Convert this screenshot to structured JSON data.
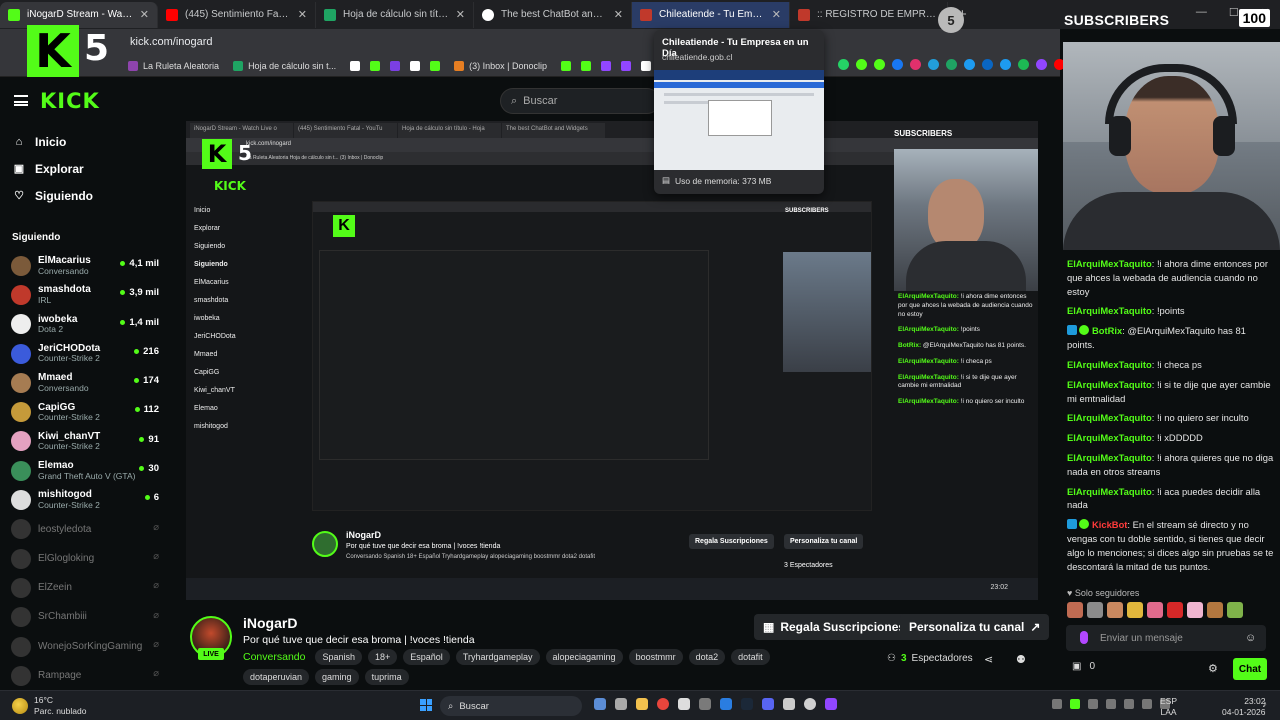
{
  "browser": {
    "tabs": [
      {
        "title": "iNogarD Stream - Watch Live o",
        "color": "#53fc18"
      },
      {
        "title": "(445) Sentimiento Fatal - YouTu",
        "color": "#ff0000"
      },
      {
        "title": "Hoja de cálculo sin título - Hoja",
        "color": "#1fa463"
      },
      {
        "title": "The best ChatBot and Widgets",
        "color": "#ffffff"
      },
      {
        "title": "Chileatiende - Tu Empresa en u",
        "color": "#c0392b"
      },
      {
        "title": ":: REGISTRO DE EMPRESAS",
        "color": "#c0392b"
      }
    ],
    "address": "kick.com/inogard",
    "bookmarks": [
      {
        "label": "La Ruleta Aleatoria",
        "color": "#8e44ad"
      },
      {
        "label": "Hoja de cálculo sin t...",
        "color": "#1fa463"
      },
      {
        "label": "(3) Inbox | Donoclip",
        "color": "#e67e22"
      }
    ]
  },
  "overlay": {
    "logo_letter": "K",
    "logo_number": "5",
    "subscribers_level": "5",
    "subscribers_label": "SUBSCRIBERS",
    "subscribers_count": "100"
  },
  "tooltip": {
    "title": "Chileatiende - Tu Empresa en un Día",
    "url": "chileatiende.gob.cl",
    "memory": "Uso de memoria: 373 MB"
  },
  "kick": {
    "logo": "KICK",
    "search_placeholder": "Buscar",
    "nav": [
      {
        "label": "Inicio",
        "icon": "home-icon",
        "glyph": "⌂"
      },
      {
        "label": "Explorar",
        "icon": "explore-icon",
        "glyph": "▣"
      },
      {
        "label": "Siguiendo",
        "icon": "heart-icon",
        "glyph": "♡"
      }
    ],
    "following_header": "Siguiendo",
    "channels": [
      {
        "name": "ElMacarius",
        "category": "Conversando",
        "viewers": "4,1 mil",
        "color": "#7b5a3a",
        "live": true
      },
      {
        "name": "smashdota",
        "category": "IRL",
        "viewers": "3,9 mil",
        "color": "#c0392b",
        "live": true
      },
      {
        "name": "iwobeka",
        "category": "Dota 2",
        "viewers": "1,4 mil",
        "color": "#eeeeee",
        "live": true
      },
      {
        "name": "JeriCHODota",
        "category": "Counter-Strike 2",
        "viewers": "216",
        "color": "#3b5bdb",
        "live": true
      },
      {
        "name": "Mmaed",
        "category": "Conversando",
        "viewers": "174",
        "color": "#a67c52",
        "live": true
      },
      {
        "name": "CapiGG",
        "category": "Counter-Strike 2",
        "viewers": "112",
        "color": "#c59a3a",
        "live": true
      },
      {
        "name": "Kiwi_chanVT",
        "category": "Counter-Strike 2",
        "viewers": "91",
        "color": "#e4a1c0",
        "live": true
      },
      {
        "name": "Elemao",
        "category": "Grand Theft Auto V (GTA)",
        "viewers": "30",
        "color": "#3a8f5a",
        "live": true
      },
      {
        "name": "mishitogod",
        "category": "Counter-Strike 2",
        "viewers": "6",
        "color": "#dddddd",
        "live": true
      },
      {
        "name": "leostyledota",
        "category": "",
        "viewers": "",
        "color": "#333",
        "live": false
      },
      {
        "name": "ElGlogloking",
        "category": "",
        "viewers": "",
        "color": "#333",
        "live": false
      },
      {
        "name": "ElZeein",
        "category": "",
        "viewers": "",
        "color": "#333",
        "live": false
      },
      {
        "name": "SrChambiii",
        "category": "",
        "viewers": "",
        "color": "#333",
        "live": false
      },
      {
        "name": "WonejoSorKingGaming",
        "category": "",
        "viewers": "",
        "color": "#333",
        "live": false
      },
      {
        "name": "Rampage",
        "category": "",
        "viewers": "",
        "color": "#333",
        "live": false
      }
    ]
  },
  "stream": {
    "streamer": "iNogarD",
    "title": "Por qué tuve que decir esa broma | !voces !tienda",
    "live_label": "LIVE",
    "category": "Conversando",
    "tags": [
      "Spanish",
      "18+",
      "Español",
      "Tryhardgameplay",
      "alopeciagaming",
      "boostmmr",
      "dota2",
      "dotafit"
    ],
    "tags2": [
      "dotaperuvian",
      "gaming",
      "tuprima"
    ],
    "subs_button": "Regala Suscripciones",
    "customize_button": "Personaliza tu canal",
    "viewers_count": "3",
    "viewers_label": "Espectadores"
  },
  "chat": {
    "messages": [
      {
        "user": "ElArquiMexTaquito",
        "text": "!i ahora dime entonces por que ahces la webada de audiencia cuando no estoy",
        "kind": "user"
      },
      {
        "user": "ElArquiMexTaquito",
        "text": "!points",
        "kind": "user"
      },
      {
        "user": "BotRix",
        "text": "@ElArquiMexTaquito has 81 points.",
        "kind": "bot"
      },
      {
        "user": "ElArquiMexTaquito",
        "text": "!i checa ps",
        "kind": "user"
      },
      {
        "user": "ElArquiMexTaquito",
        "text": "!i si te dije que ayer cambie mi emtnalidad",
        "kind": "user"
      },
      {
        "user": "ElArquiMexTaquito",
        "text": "!i no quiero ser inculto",
        "kind": "user"
      },
      {
        "user": "ElArquiMexTaquito",
        "text": "!i xDDDDD",
        "kind": "user"
      },
      {
        "user": "ElArquiMexTaquito",
        "text": "!i ahora quieres que no diga nada en otros streams",
        "kind": "user"
      },
      {
        "user": "ElArquiMexTaquito",
        "text": "!i aca puedes decidir alla nada",
        "kind": "user"
      },
      {
        "user": "KickBot",
        "text": "En el stream sé directo y no vengas con tu doble sentido, si tienes que decir algo lo menciones; si dices algo sin pruebas se te descontará la mitad de tus puntos.",
        "kind": "red"
      }
    ],
    "followers_only": "Solo seguidores",
    "input_placeholder": "Enviar un mensaje",
    "points": "0",
    "send_label": "Chat"
  },
  "player_inner": {
    "tab_titles": [
      "iNogarD Stream - Watch Live o",
      "(445) Sentimiento Fatal - YouTu",
      "Hoja de cálculo sin título - Hoja",
      "The best ChatBot and Widgets"
    ],
    "address": "kick.com/inogard",
    "bookmarks": "La Ruleta Aleatoria   Hoja de cálculo sin t...   (3) Inbox | Donoclip",
    "logo": "KICK",
    "nav": [
      "Inicio",
      "Explorar",
      "Siguiendo"
    ],
    "following": "Siguiendo",
    "channels": [
      "ElMacarius",
      "smashdota",
      "iwobeka",
      "JeriCHODota",
      "Mmaed",
      "CapiGG",
      "Kiwi_chanVT",
      "Elemao",
      "mishitogod"
    ],
    "chat": [
      {
        "u": "ElArquiMexTaquito:",
        "t": "!i ahora dime entonces por que ahces la webada de audiencia cuando no estoy"
      },
      {
        "u": "ElArquiMexTaquito:",
        "t": "!points"
      },
      {
        "u": "BotRix:",
        "t": "@ElArquiMexTaquito has 81 points."
      },
      {
        "u": "ElArquiMexTaquito:",
        "t": "!i checa ps"
      },
      {
        "u": "ElArquiMexTaquito:",
        "t": "!i si te dije que ayer cambie mi emtnalidad"
      },
      {
        "u": "ElArquiMexTaquito:",
        "t": "!i no quiero ser inculto"
      }
    ],
    "streamer": "iNogarD",
    "title": "Por qué tuve que decir esa broma | !voces !tienda",
    "tags": "Conversando  Spanish  18+  Español  Tryhardgameplay  alopeciagaming  boostmmr  dota2  dotafit",
    "subs_button": "Regala Suscripciones",
    "customize_button": "Personaliza tu canal",
    "viewers": "3 Espectadores",
    "taskbar_time": "23:02"
  },
  "taskbar": {
    "temp": "16°C",
    "weather": "Parc. nublado",
    "search": "Buscar",
    "lang1": "ESP",
    "lang2": "LAA",
    "time": "23:02",
    "date": "04-01-2026"
  }
}
